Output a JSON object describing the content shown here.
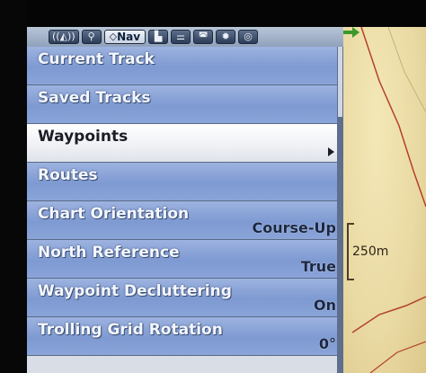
{
  "tabs": [
    {
      "icon": "sonar-icon",
      "label": ""
    },
    {
      "icon": "antenna-icon",
      "label": ""
    },
    {
      "icon": "nav-icon",
      "label": "Nav",
      "active": true
    },
    {
      "icon": "chart-icon",
      "label": ""
    },
    {
      "icon": "settings-icon",
      "label": ""
    },
    {
      "icon": "screen-icon",
      "label": ""
    },
    {
      "icon": "gear-icon",
      "label": ""
    },
    {
      "icon": "globe-icon",
      "label": ""
    }
  ],
  "nav_tab_glyph": "◇",
  "menu": {
    "items": [
      {
        "label": "Current Track",
        "value": ""
      },
      {
        "label": "Saved Tracks",
        "value": ""
      },
      {
        "label": "Waypoints",
        "value": "",
        "selected": true,
        "has_submenu": true
      },
      {
        "label": "Routes",
        "value": ""
      },
      {
        "label": "Chart Orientation",
        "value": "Course-Up"
      },
      {
        "label": "North Reference",
        "value": "True"
      },
      {
        "label": "Waypoint Decluttering",
        "value": "On"
      },
      {
        "label": "Trolling Grid Rotation",
        "value": "0°"
      }
    ]
  },
  "map": {
    "scale_label": "250m"
  },
  "colors": {
    "menu_item": "#8aa4d8",
    "menu_selected": "#ffffff",
    "map_land": "#e9d9a2",
    "contour_red": "#b3412a"
  }
}
